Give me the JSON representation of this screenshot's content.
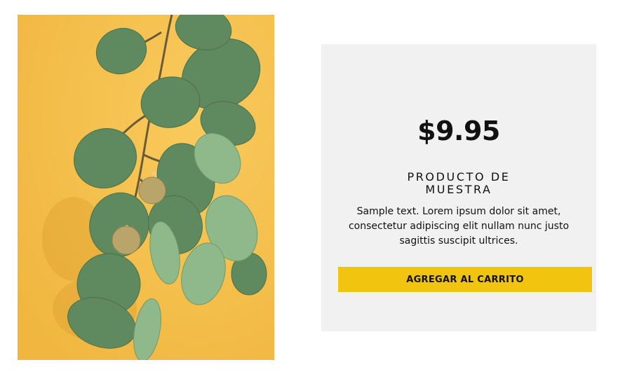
{
  "product": {
    "image_icon": "eucalyptus-branch-with-earrings",
    "price": "$9.95",
    "title": "PRODUCTO DE MUESTRA",
    "description": "Sample text. Lorem ipsum dolor sit amet, consectetur adipiscing elit nullam nunc justo sagittis suscipit ultrices.",
    "cart_button_label": "AGREGAR AL CARRITO"
  },
  "colors": {
    "image_background": "#f6c24f",
    "card_background": "#f1f1f1",
    "button": "#f1c40f",
    "text": "#111111"
  }
}
